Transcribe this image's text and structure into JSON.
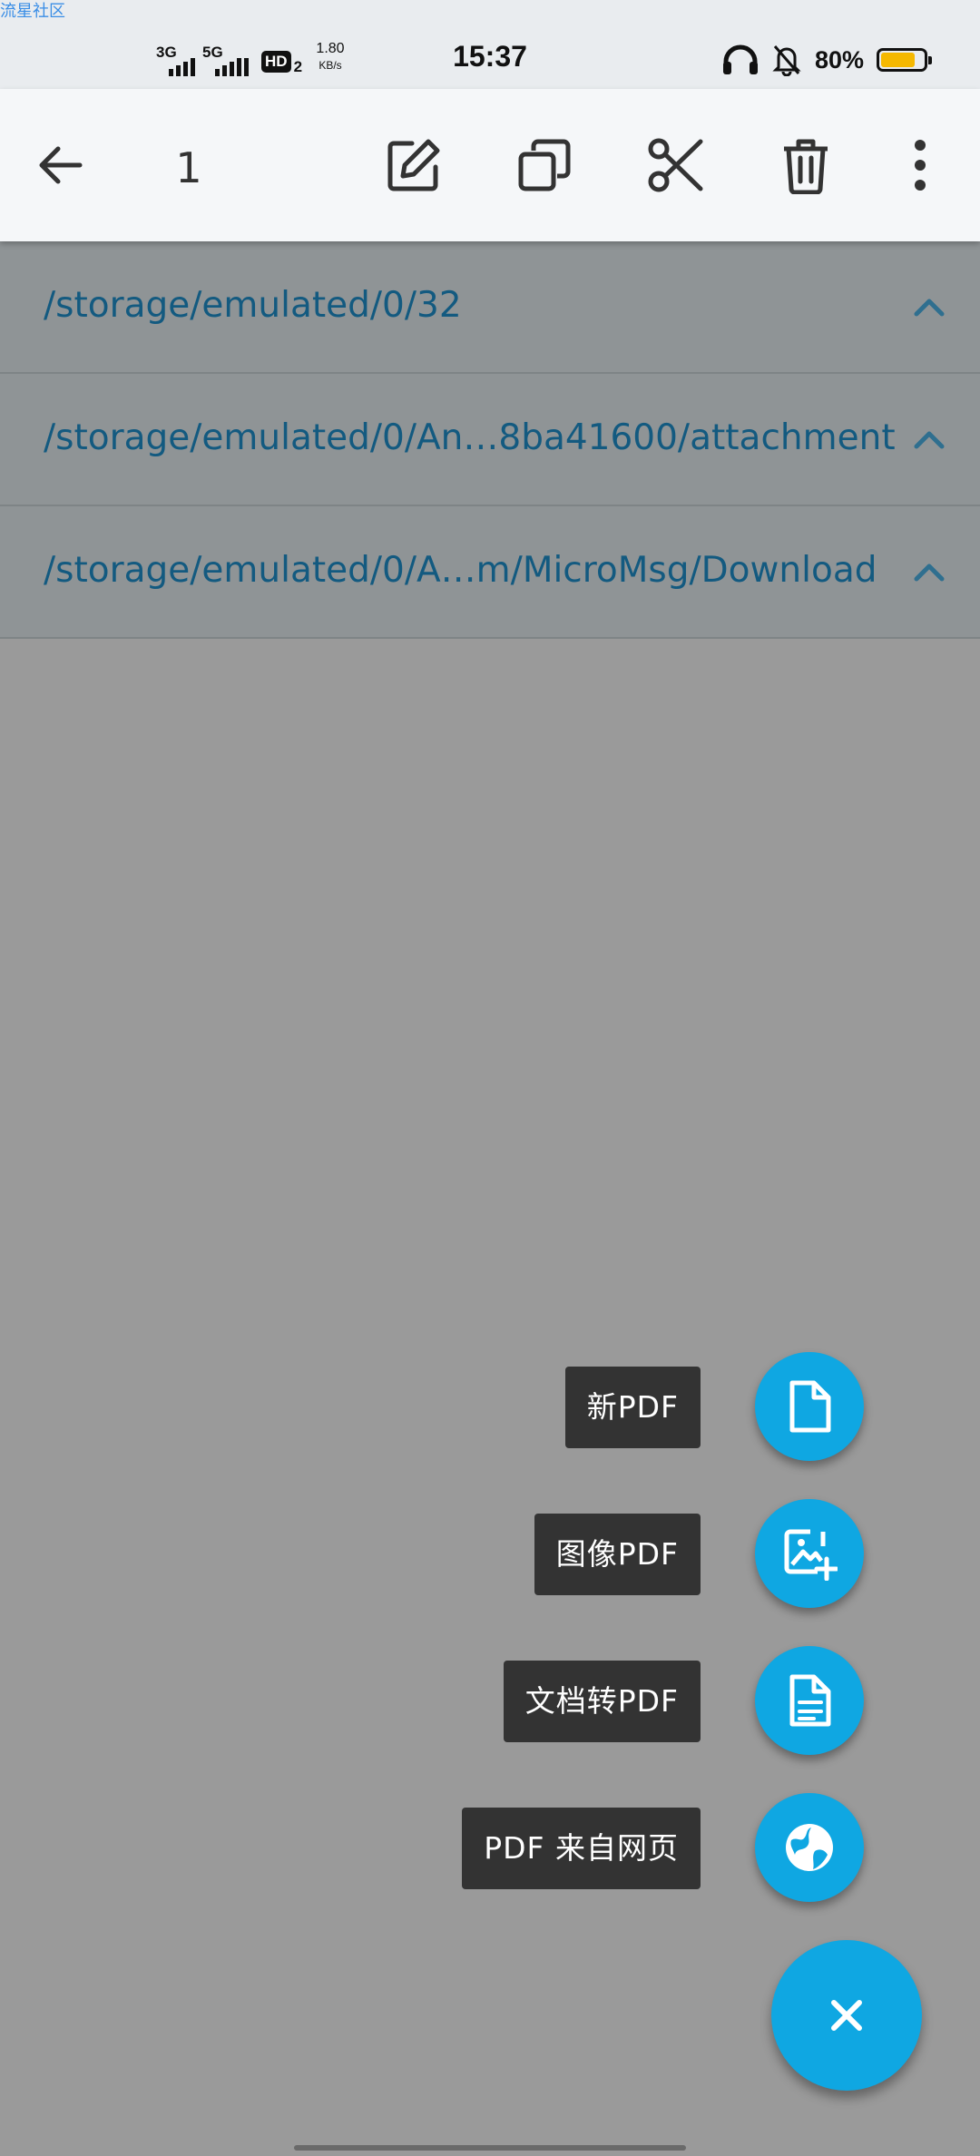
{
  "status_bar": {
    "watermark": "流星社区",
    "net1_label": "3G",
    "net2_label": "5G",
    "hd_label": "HD",
    "hd_sub": "2",
    "speed_value": "1.80",
    "speed_unit": "KB/s",
    "time": "15:37",
    "battery_percent": "80%",
    "battery_level": 0.8,
    "battery_color": "#f5b800",
    "icons": [
      "headphones-icon",
      "bell-off-icon",
      "battery-icon"
    ]
  },
  "toolbar": {
    "selected_count": "1",
    "icons": [
      "arrow-left-icon",
      "edit-icon",
      "copy-icon",
      "scissors-icon",
      "trash-icon",
      "more-vertical-icon"
    ]
  },
  "folders": [
    {
      "path": "/storage/emulated/0/32"
    },
    {
      "path": "/storage/emulated/0/An…8ba41600/attachment"
    },
    {
      "path": "/storage/emulated/0/A…m/MicroMsg/Download"
    }
  ],
  "fab_menu": {
    "items": [
      {
        "label": "新PDF",
        "icon": "file-icon"
      },
      {
        "label": "图像PDF",
        "icon": "image-add-icon"
      },
      {
        "label": "文档转PDF",
        "icon": "document-icon"
      },
      {
        "label": "PDF 来自网页",
        "icon": "globe-icon"
      }
    ],
    "close_icon": "close-icon",
    "accent_color": "#0fa7e2"
  }
}
